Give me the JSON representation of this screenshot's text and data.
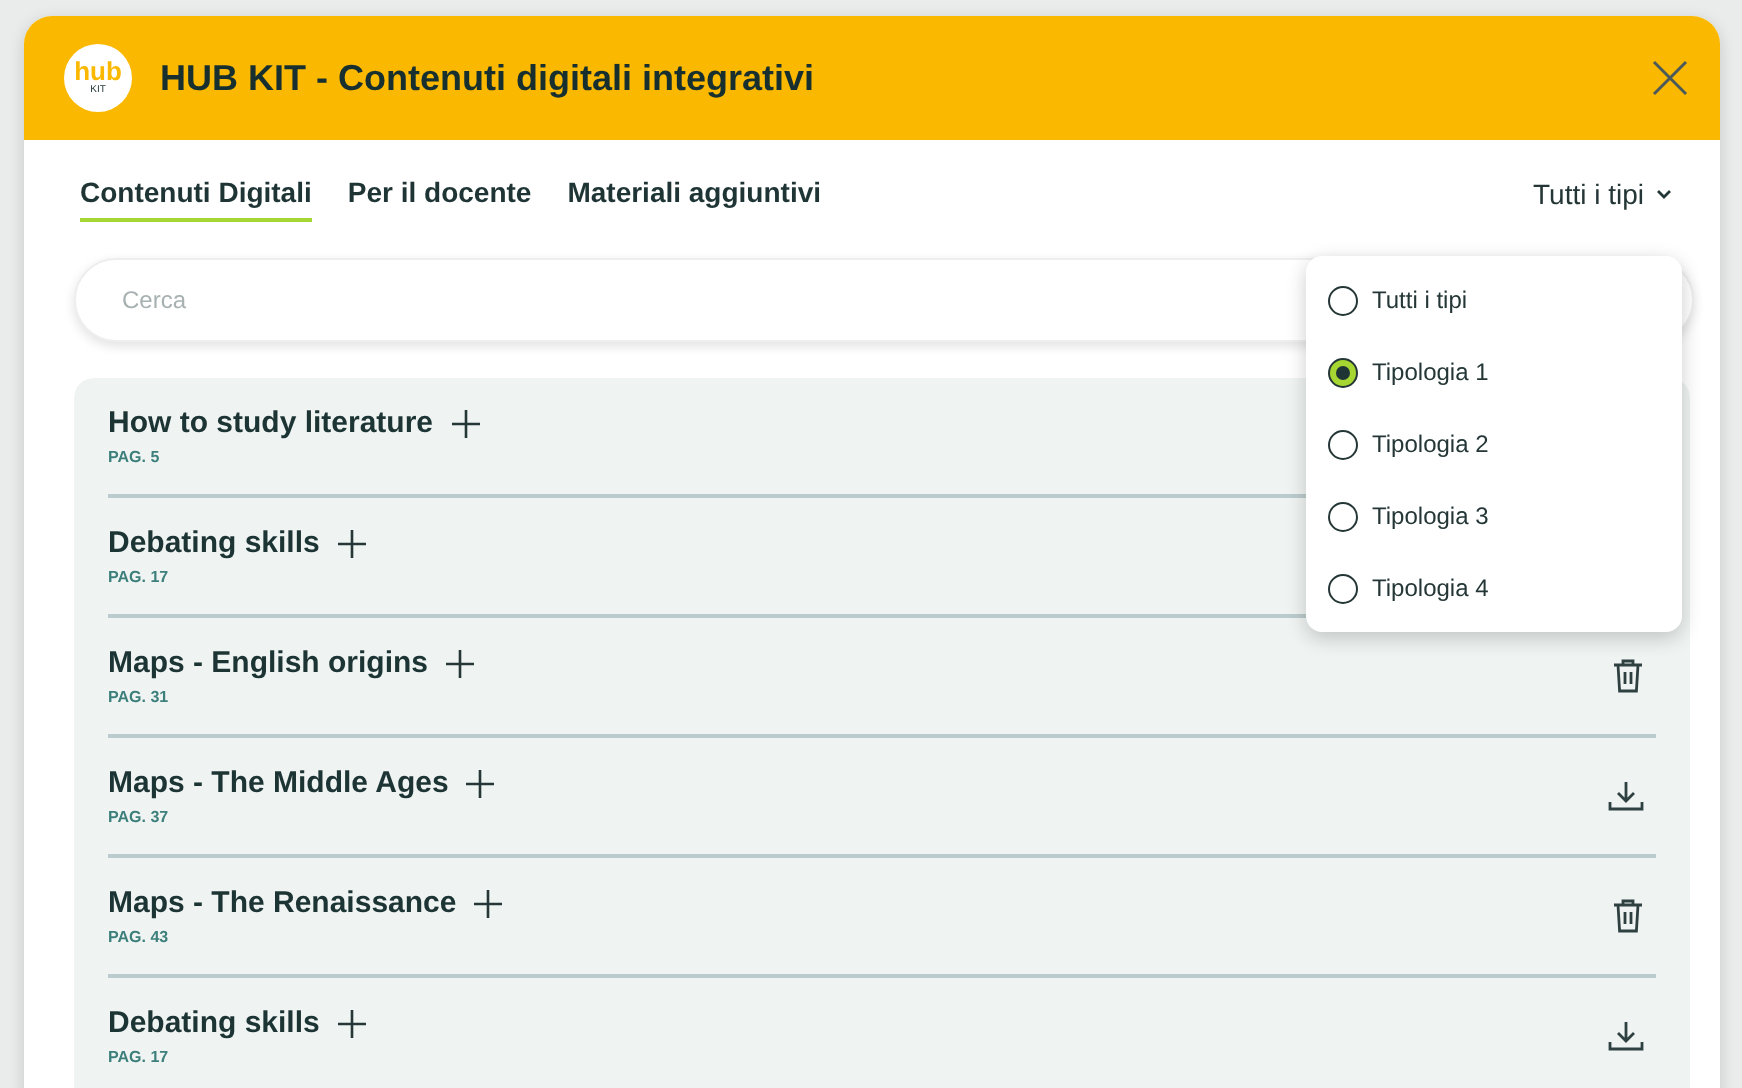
{
  "window": {
    "title": "HUB KIT - Contenuti digitali integrativi",
    "logo": {
      "text": "hub",
      "subtext": "KIT"
    }
  },
  "tabs": [
    {
      "label": "Contenuti Digitali",
      "selected": true
    },
    {
      "label": "Per il docente",
      "selected": false
    },
    {
      "label": "Materiali aggiuntivi",
      "selected": false
    }
  ],
  "filter": {
    "label": "Tutti i tipi",
    "expanded": true,
    "options": [
      {
        "label": "Tutti i tipi",
        "selected": false
      },
      {
        "label": "Tipologia 1",
        "selected": true
      },
      {
        "label": "Tipologia 2",
        "selected": false
      },
      {
        "label": "Tipologia 3",
        "selected": false
      },
      {
        "label": "Tipologia 4",
        "selected": false
      }
    ]
  },
  "search": {
    "placeholder": "Cerca"
  },
  "items": [
    {
      "title": "How to study literature",
      "page": "PAG. 5"
    },
    {
      "title": "Debating skills",
      "page": "PAG. 17"
    },
    {
      "title": "Maps - English origins",
      "page": "PAG. 31",
      "kind": "delete"
    },
    {
      "title": "Maps - The Middle Ages",
      "page": "PAG. 37",
      "kind": "download"
    },
    {
      "title": "Maps - The Renaissance",
      "page": "PAG. 43",
      "kind": "delete"
    },
    {
      "title": "Debating skills",
      "page": "PAG. 17",
      "kind": "download"
    }
  ]
}
